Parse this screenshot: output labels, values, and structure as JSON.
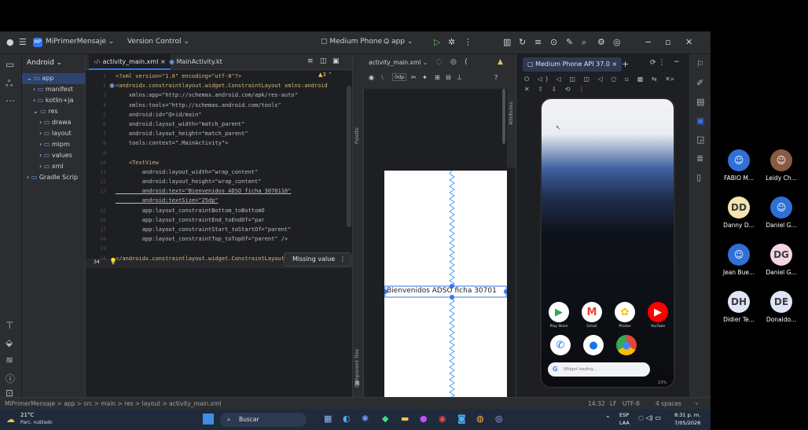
{
  "titlebar": {
    "project": "MiPrimerMensaje",
    "vcs": "Version Control",
    "device": "Medium Phone",
    "run_config": "app"
  },
  "project_panel": {
    "title": "Android",
    "items": [
      {
        "label": "app",
        "depth": 0
      },
      {
        "label": "manifest",
        "depth": 1
      },
      {
        "label": "kotlin+ja",
        "depth": 1
      },
      {
        "label": "res",
        "depth": 1
      },
      {
        "label": "drawa",
        "depth": 2
      },
      {
        "label": "layout",
        "depth": 2
      },
      {
        "label": "mipm",
        "depth": 2
      },
      {
        "label": "values",
        "depth": 2
      },
      {
        "label": "xml",
        "depth": 2
      },
      {
        "label": "Gradle Scrip",
        "depth": 0
      }
    ]
  },
  "editor": {
    "tabs": [
      "activity_main.xml",
      "MainActivity.kt"
    ],
    "warnings": "3",
    "line_numbers": [
      "1",
      "2",
      "3",
      "4",
      "5",
      "6",
      "7",
      "8",
      "9",
      "10",
      "11",
      "12",
      "13",
      "14",
      "15",
      "16",
      "17",
      "18",
      "19",
      "20"
    ],
    "current_line": "34",
    "lines": [
      "<?xml version=\"1.0\" encoding=\"utf-8\"?>",
      "<androidx.constraintlayout.widget.ConstraintLayout xmlns:android",
      "    xmlns:app=\"http://schemas.android.com/apk/res-auto\"",
      "    xmlns:tools=\"http://schemas.android.com/tools\"",
      "    android:id=\"@+id/main\"",
      "    android:layout_width=\"match_parent\"",
      "    android:layout_height=\"match_parent\"",
      "    tools:context=\".MainActivity\">",
      "",
      "    <TextView",
      "        android:layout_width=\"wrap_content\"",
      "        android:layout_height=\"wrap_content\"",
      "        android:text=\"Bienvenidos ADSO ficha 3070110\"",
      "        android:textSize=\"25dp\"",
      "        app:layout_constraintBottom_toBottomO",
      "        app:layout_constraintEnd_toEndOf=\"par",
      "        app:layout_constraintStart_toStartOf=\"parent\"",
      "        app:layout_constraintTop_toTopOf=\"parent\" />",
      "",
      "</androidx.constraintlayout.widget.ConstraintLayout>"
    ],
    "popup": "Missing value"
  },
  "design": {
    "file": "activity_main.xml",
    "dp_label": "0dp",
    "preview_text": "Bienvenidos ADSO ficha 30701",
    "palette_label": "Palette",
    "component_tree_label": "Component Tree",
    "attributes_label": "Attributes"
  },
  "emulator": {
    "tab": "Medium Phone API 37.0",
    "apps": [
      {
        "label": "Play Store",
        "color": "#ffffff"
      },
      {
        "label": "Gmail",
        "color": "#ffffff"
      },
      {
        "label": "Photos",
        "color": "#ffffff"
      },
      {
        "label": "YouTube",
        "color": "#ff0000"
      }
    ],
    "search_hint": "Widget loading...",
    "zoom": "13%"
  },
  "statusbar": {
    "breadcrumb": "MiPrimerMensaje  >  app  >  src  >  main  >  res  >  layout  >  activity_main.xml",
    "position": "14:32",
    "line_sep": "LF",
    "encoding": "UTF-8",
    "indent": "4 spaces"
  },
  "taskbar": {
    "weather_temp": "21°C",
    "weather_desc": "Parc. nublado",
    "search": "Buscar",
    "lang": "ESP",
    "lang2": "LAA",
    "time": "8:31 p. m.",
    "date": "7/05/2026"
  },
  "participants": [
    {
      "name": "FABIO M...",
      "initials": "",
      "color": "#2f6fd6"
    },
    {
      "name": "Leidy Ch...",
      "initials": "",
      "color": "#8a5a44"
    },
    {
      "name": "Danny D...",
      "initials": "DD",
      "color": "#f4e4b0"
    },
    {
      "name": "Daniel G...",
      "initials": "",
      "color": "#2f6fd6"
    },
    {
      "name": "Jean Bue...",
      "initials": "",
      "color": "#2f6fd6"
    },
    {
      "name": "Daniel G...",
      "initials": "DG",
      "color": "#f4d4e4"
    },
    {
      "name": "Didier Te...",
      "initials": "DH",
      "color": "#dfe5f6"
    },
    {
      "name": "Donaldo...",
      "initials": "DE",
      "color": "#dfe5f6"
    }
  ]
}
